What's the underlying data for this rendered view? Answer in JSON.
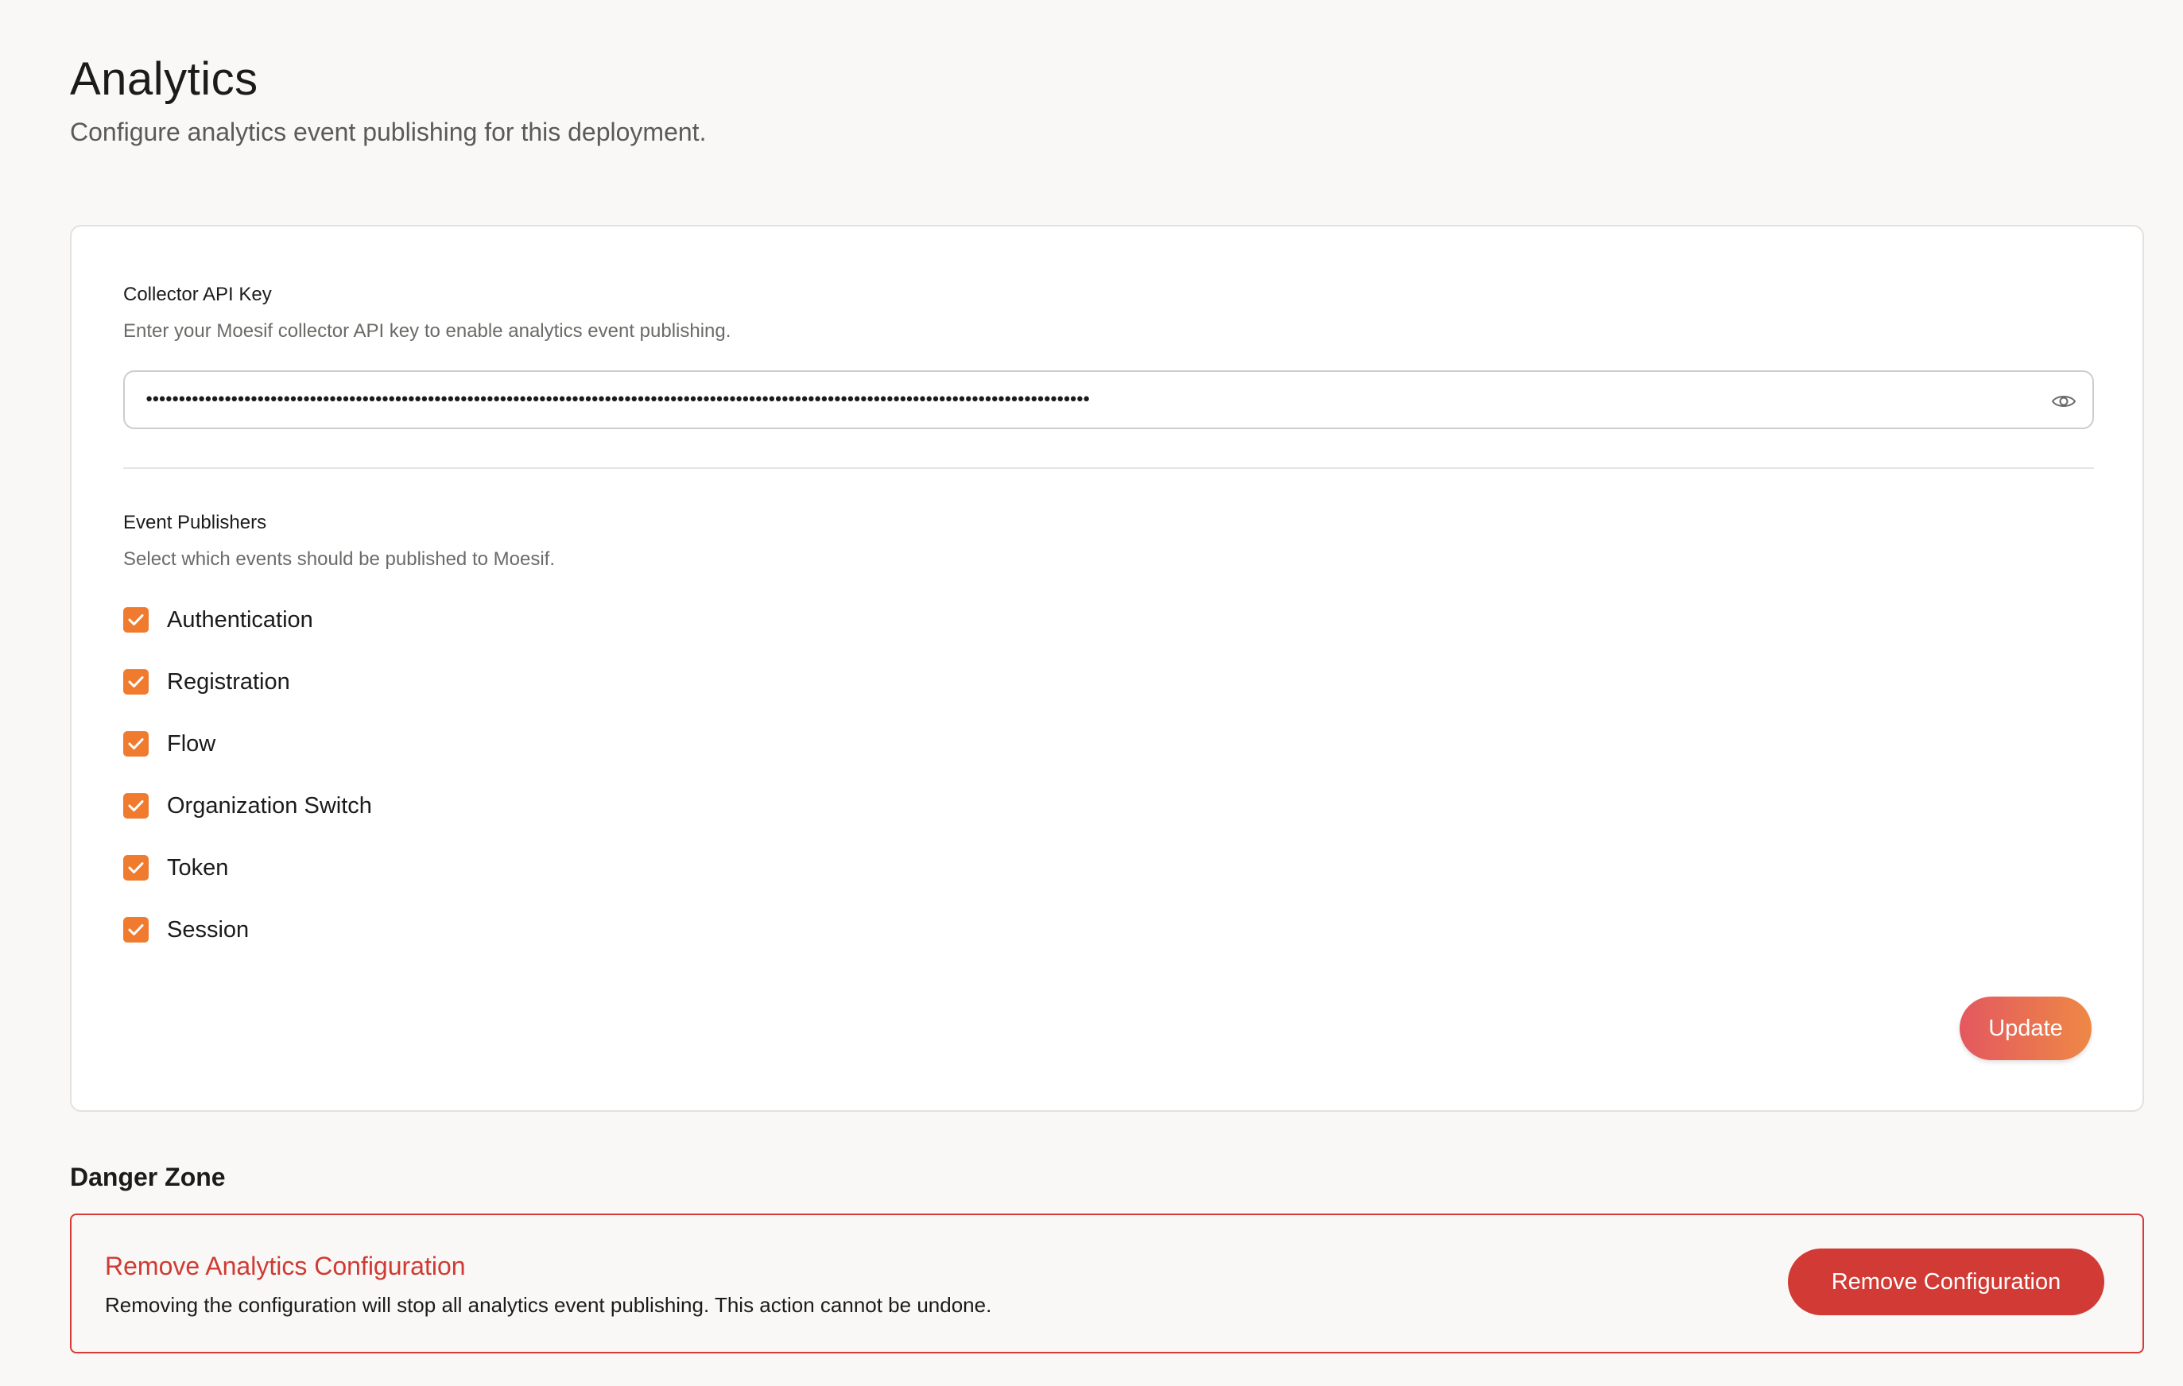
{
  "header": {
    "title": "Analytics",
    "subtitle": "Configure analytics event publishing for this deployment."
  },
  "api_key": {
    "label": "Collector API Key",
    "help": "Enter your Moesif collector API key to enable analytics event publishing.",
    "masked_value": "••••••••••••••••••••••••••••••••••••••••••••••••••••••••••••••••••••••••••••••••••••••••••••••••••••••••••••••••••••••••••••••••••••••••••••••••",
    "reveal_icon": "eye-icon"
  },
  "publishers": {
    "label": "Event Publishers",
    "help": "Select which events should be published to Moesif.",
    "items": [
      {
        "label": "Authentication",
        "checked": true
      },
      {
        "label": "Registration",
        "checked": true
      },
      {
        "label": "Flow",
        "checked": true
      },
      {
        "label": "Organization Switch",
        "checked": true
      },
      {
        "label": "Token",
        "checked": true
      },
      {
        "label": "Session",
        "checked": true
      }
    ]
  },
  "actions": {
    "update_label": "Update"
  },
  "danger_zone": {
    "title": "Danger Zone",
    "heading": "Remove Analytics Configuration",
    "description": "Removing the configuration will stop all analytics event publishing. This action cannot be undone.",
    "button_label": "Remove Configuration"
  },
  "colors": {
    "accent": "#f07b2f",
    "danger": "#d23b35",
    "update_gradient_start": "#e3585f",
    "update_gradient_end": "#ee8846",
    "background": "#f9f8f6"
  }
}
